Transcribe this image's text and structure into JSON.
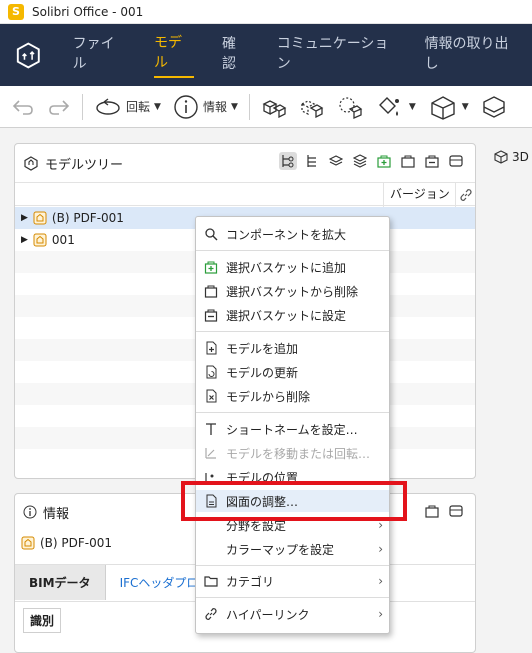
{
  "window": {
    "title": "Solibri Office - 001",
    "app_icon_letter": "S"
  },
  "menu": {
    "items": [
      "ファイル",
      "モデル",
      "確認",
      "コミュニケーション",
      "情報の取り出し"
    ],
    "active_index": 1
  },
  "toolbar": {
    "rotate_label": "回転",
    "info_label": "情報"
  },
  "model_tree": {
    "title": "モデルツリー",
    "version_header": "バージョン",
    "rows": [
      {
        "label": "(B) PDF-001",
        "selected": true
      },
      {
        "label": "001",
        "selected": false
      }
    ]
  },
  "view3d": {
    "label": "3D"
  },
  "info_panel": {
    "title": "情報",
    "model_name": "(B) PDF-001",
    "tabs": [
      "BIMデータ",
      "IFCヘッダプロパ"
    ],
    "subtab": "識別"
  },
  "context_menu": {
    "items": [
      {
        "label": "コンポーネントを拡大",
        "icon": "search-icon"
      },
      {
        "label": "選択バスケットに追加",
        "icon": "basket-add-icon"
      },
      {
        "label": "選択バスケットから削除",
        "icon": "basket-remove-icon"
      },
      {
        "label": "選択バスケットに設定",
        "icon": "basket-set-icon"
      },
      {
        "label": "モデルを追加",
        "icon": "add-model-icon"
      },
      {
        "label": "モデルの更新",
        "icon": "update-model-icon"
      },
      {
        "label": "モデルから削除",
        "icon": "remove-model-icon"
      },
      {
        "label": "ショートネームを設定…",
        "icon": "text-icon"
      },
      {
        "label": "モデルを移動または回転…",
        "icon": "move-icon",
        "disabled": true
      },
      {
        "label": "モデルの位置",
        "icon": "position-icon"
      },
      {
        "label": "図面の調整…",
        "icon": "drawing-adjust-icon",
        "highlighted": true
      },
      {
        "label": "分野を設定",
        "submenu": true
      },
      {
        "label": "カラーマップを設定",
        "submenu": true
      },
      {
        "label": "カテゴリ",
        "icon": "folder-icon",
        "submenu": true
      },
      {
        "label": "ハイパーリンク",
        "icon": "link-icon",
        "submenu": true
      }
    ]
  }
}
